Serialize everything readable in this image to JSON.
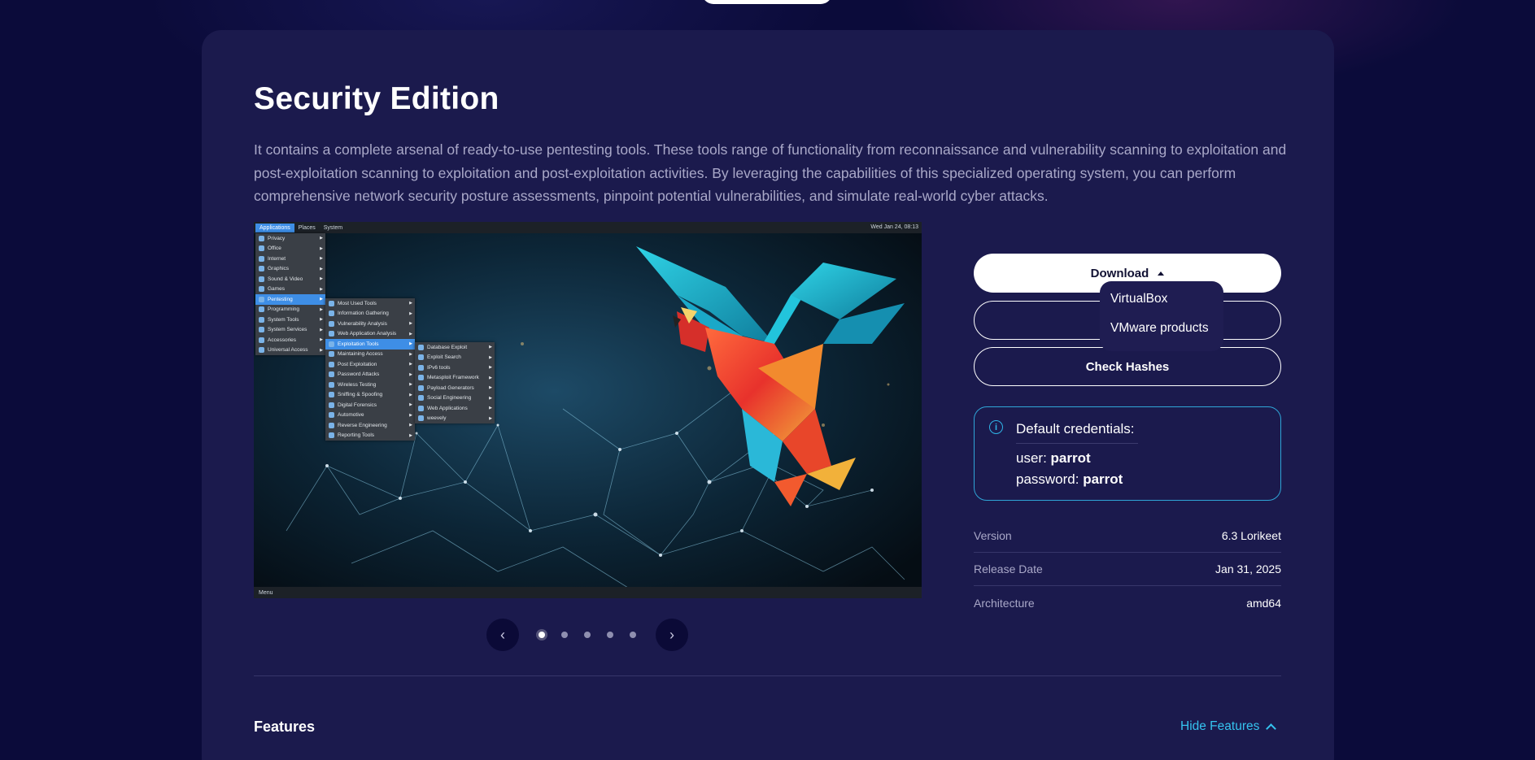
{
  "edition": {
    "title": "Security Edition",
    "description": "It contains a complete arsenal of ready-to-use pentesting tools. These tools range of functionality from reconnaissance and vulnerability scanning to exploitation and post-exploitation scanning to exploitation and post-exploitation activities. By leveraging the capabilities of this specialized operating system, you can perform comprehensive network security posture assessments, pinpoint potential vulnerabilities, and simulate real-world cyber attacks."
  },
  "screenshot": {
    "topbar": {
      "applications": "Applications",
      "places": "Places",
      "system": "System",
      "datetime": "Wed Jan 24, 08:13"
    },
    "bottombar": {
      "menu": "Menu"
    },
    "menu_main": [
      {
        "label": "Privacy"
      },
      {
        "label": "Office"
      },
      {
        "label": "Internet"
      },
      {
        "label": "Graphics"
      },
      {
        "label": "Sound & Video"
      },
      {
        "label": "Games"
      },
      {
        "label": "Pentesting"
      },
      {
        "label": "Programming"
      },
      {
        "label": "System Tools"
      },
      {
        "label": "System Services"
      },
      {
        "label": "Accessories"
      },
      {
        "label": "Universal Access"
      }
    ],
    "menu_pentest": [
      {
        "label": "Most Used Tools"
      },
      {
        "label": "Information Gathering"
      },
      {
        "label": "Vulnerability Analysis"
      },
      {
        "label": "Web Application Analysis"
      },
      {
        "label": "Exploitation Tools"
      },
      {
        "label": "Maintaining Access"
      },
      {
        "label": "Post Exploitation"
      },
      {
        "label": "Password Attacks"
      },
      {
        "label": "Wireless Testing"
      },
      {
        "label": "Sniffing & Spoofing"
      },
      {
        "label": "Digital Forensics"
      },
      {
        "label": "Automotive"
      },
      {
        "label": "Reverse Engineering"
      },
      {
        "label": "Reporting Tools"
      }
    ],
    "menu_exploit": [
      {
        "label": "Database Exploit"
      },
      {
        "label": "Exploit Search"
      },
      {
        "label": "IPv6 tools"
      },
      {
        "label": "Metasploit Framework"
      },
      {
        "label": "Payload Generators"
      },
      {
        "label": "Social Engineering"
      },
      {
        "label": "Web Applications"
      },
      {
        "label": "weevely"
      }
    ]
  },
  "carousel": {
    "prev": "‹",
    "next": "›",
    "slide_count": 5,
    "active_index": 0
  },
  "actions": {
    "download_label": "Download",
    "check_hashes_label": "Check Hashes",
    "dropdown": [
      "VirtualBox",
      "VMware products"
    ]
  },
  "credentials": {
    "icon": "info-icon",
    "title": "Default credentials:",
    "user_label": "user: ",
    "user_value": "parrot",
    "password_label": "password: ",
    "password_value": "parrot"
  },
  "details": [
    {
      "key": "Version",
      "value": "6.3 Lorikeet"
    },
    {
      "key": "Release Date",
      "value": "Jan 31, 2025"
    },
    {
      "key": "Architecture",
      "value": "amd64"
    }
  ],
  "features": {
    "heading": "Features",
    "toggle_label": "Hide Features"
  },
  "colors": {
    "page_bg": "#0b0b3a",
    "card_bg": "#1b1a4d",
    "accent": "#35c3ef",
    "muted_text": "#a9a8c8"
  }
}
